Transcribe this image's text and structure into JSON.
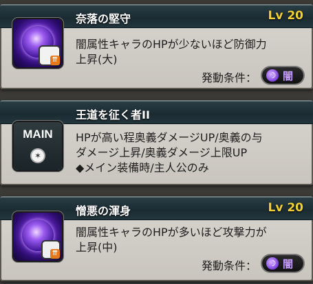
{
  "skills": [
    {
      "name": "奈落の堅守",
      "level": "Lv 20",
      "icon": "dark-defense-up-icon",
      "desc_lines": [
        "闇属性キャラのHPが少ないほど防御力",
        "上昇(大)"
      ],
      "condition_label": "発動条件：",
      "condition_element": "闇"
    },
    {
      "name": "王道を征く者II",
      "level": "",
      "icon": "main-compass-icon",
      "icon_label": "MAIN",
      "desc_lines": [
        "HPが高い程奥義ダメージUP/奥義の与",
        "ダメージ上昇/奥義ダメージ上限UP",
        "◆メイン装備時/主人公のみ"
      ]
    },
    {
      "name": "憎悪の渾身",
      "level": "Lv 20",
      "icon": "dark-attack-up-icon",
      "desc_lines": [
        "闇属性キャラのHPが多いほど攻撃力が",
        "上昇(中)"
      ],
      "condition_label": "発動条件：",
      "condition_element": "闇"
    }
  ],
  "colors": {
    "header_bg": "#1b2b32",
    "level_text": "#f2cf32",
    "card_bg": "#d8d5cf",
    "dark_element": "#7c3fe0"
  }
}
